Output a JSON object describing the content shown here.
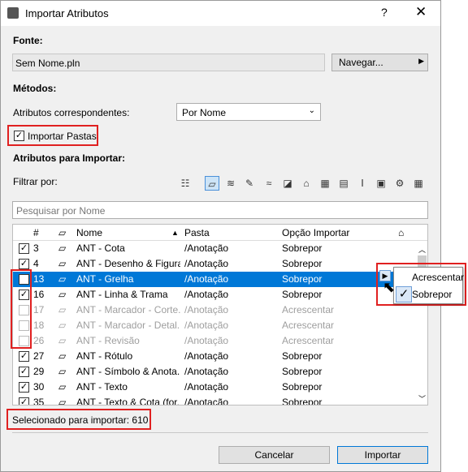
{
  "window": {
    "title": "Importar Atributos",
    "help": "?",
    "close": "✕"
  },
  "source": {
    "label": "Fonte:",
    "value": "Sem Nome.pln",
    "browse": "Navegar..."
  },
  "methods": {
    "label": "Métodos:",
    "match_label": "Atributos correspondentes:",
    "match_value": "Por Nome",
    "import_folders": "Importar Pastas",
    "import_folders_checked": true
  },
  "attributes": {
    "label": "Atributos para Importar:",
    "filter_label": "Filtrar por:",
    "search_placeholder": "Pesquisar por Nome"
  },
  "table": {
    "headers": {
      "num": "#",
      "name": "Nome",
      "folder": "Pasta",
      "option": "Opção Importar"
    },
    "rows": [
      {
        "checked": true,
        "num": "3",
        "name": "ANT - Cota",
        "folder": "/Anotação",
        "option": "Sobrepor",
        "state": "normal"
      },
      {
        "checked": true,
        "num": "4",
        "name": "ANT - Desenho & Figura",
        "folder": "/Anotação",
        "option": "Sobrepor",
        "state": "normal"
      },
      {
        "checked": true,
        "num": "13",
        "name": "ANT - Grelha",
        "folder": "/Anotação",
        "option": "Sobrepor",
        "state": "selected"
      },
      {
        "checked": true,
        "num": "16",
        "name": "ANT - Linha & Trama",
        "folder": "/Anotação",
        "option": "Sobrepor",
        "state": "normal"
      },
      {
        "checked": false,
        "num": "17",
        "name": "ANT - Marcador - Corte...",
        "folder": "/Anotação",
        "option": "Acrescentar",
        "state": "dim"
      },
      {
        "checked": false,
        "num": "18",
        "name": "ANT - Marcador - Detal...",
        "folder": "/Anotação",
        "option": "Acrescentar",
        "state": "dim"
      },
      {
        "checked": false,
        "num": "26",
        "name": "ANT - Revisão",
        "folder": "/Anotação",
        "option": "Acrescentar",
        "state": "dim"
      },
      {
        "checked": true,
        "num": "27",
        "name": "ANT - Rótulo",
        "folder": "/Anotação",
        "option": "Sobrepor",
        "state": "normal"
      },
      {
        "checked": true,
        "num": "29",
        "name": "ANT - Símbolo & Anota...",
        "folder": "/Anotação",
        "option": "Sobrepor",
        "state": "normal"
      },
      {
        "checked": true,
        "num": "30",
        "name": "ANT - Texto",
        "folder": "/Anotação",
        "option": "Sobrepor",
        "state": "normal"
      },
      {
        "checked": true,
        "num": "35",
        "name": "ANT - Texto & Cota (for...",
        "folder": "/Anotação",
        "option": "Sobrepor",
        "state": "normal"
      }
    ]
  },
  "popup": {
    "items": [
      "Acrescentar",
      "Sobrepor"
    ],
    "selected": "Sobrepor"
  },
  "status": {
    "selected_count": "Selecionado para importar: 610"
  },
  "footer": {
    "cancel": "Cancelar",
    "import": "Importar"
  },
  "colors": {
    "selection": "#0078d7",
    "highlight": "#e02020"
  }
}
